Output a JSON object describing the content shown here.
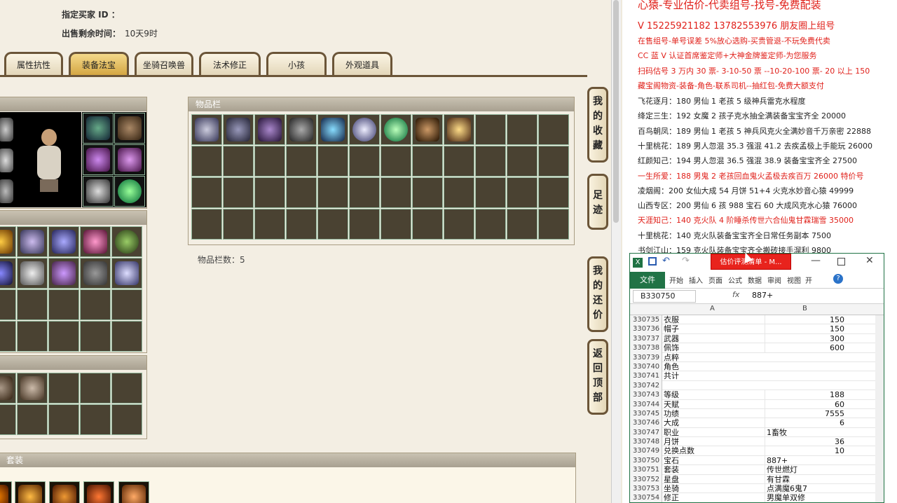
{
  "listing": {
    "buyer_label": "指定买家 ID ：",
    "buyer_value": "",
    "time_label": "出售剩余时间：",
    "time_value": "10天9时"
  },
  "tabs": [
    {
      "label": "属性抗性",
      "active": false
    },
    {
      "label": "装备法宝",
      "active": true
    },
    {
      "label": "坐骑召唤兽",
      "active": false
    },
    {
      "label": "法术修正",
      "active": false
    },
    {
      "label": "小孩",
      "active": false
    },
    {
      "label": "外观道具",
      "active": false
    }
  ],
  "inventory": {
    "header": "物品栏",
    "count_label": "物品栏数：5"
  },
  "bottom_panel": {
    "header": "套装"
  },
  "side_buttons": [
    {
      "label": "我的收藏"
    },
    {
      "label": "足迹"
    },
    {
      "label": "我的还价"
    },
    {
      "label": "返回顶部"
    }
  ],
  "ads": [
    {
      "text": "心猿-专业估价-代卖组号-找号-免费配装",
      "color": "red"
    },
    {
      "text": "V 15225921182   13782553976 朋友圈上组号",
      "color": "red"
    },
    {
      "text": "在售组号-单号误差 5%放心选购-买贵管退-不玩免费代卖",
      "color": "red"
    },
    {
      "text": "CC 蓝 V 认证首席鉴定师+大神金牌鉴定师-为您服务",
      "color": "red"
    },
    {
      "text": "扫码估号 3 万内 30 票- 3-10-50 票  --10-20-100 票- 20 以上 150",
      "color": "red"
    },
    {
      "text": "藏宝阁物资-装备-角色-联系司机--抽红包-免费大额支付",
      "color": "red"
    },
    {
      "text": "飞花逐月：180 男仙 1 老孩 5 级神兵雷克水程度",
      "color": "dark"
    },
    {
      "text": "绛定三生：192 女魔 2 孩子克水抽全满装备宝宝齐全 20000",
      "color": "dark"
    },
    {
      "text": "百鸟朝凤：189 男仙 1 老孩 5 神兵风克火全满妙音千万亲密 22888",
      "color": "dark"
    },
    {
      "text": "十里桃花：189 男人忽混 35.3 强混 41.2 去疾孟极上手能玩 26000",
      "color": "dark"
    },
    {
      "text": "红颜知己：194 男人忽混 36.5 强混 38.9 装备宝宝齐全 27500",
      "color": "dark"
    },
    {
      "text": "一生所爱：188 男鬼 2 老孩回血鬼火孟极去疾百万 26000 特价号",
      "color": "red"
    },
    {
      "text": "凌烟阁：200 女仙大成 54 月饼 51+4 火克水妙音心猿 49999",
      "color": "dark"
    },
    {
      "text": "山西专区：200 男仙 6 孩 988 宝石 60 大成风克水心猿 76000",
      "color": "dark"
    },
    {
      "text": "天涯知己：140 克火队 4 阶睡杀传世六合仙鬼甘霖瑞雪 35000",
      "color": "red"
    },
    {
      "text": "十里桃花：140 克火队装备宝宝齐全日常任务副本 7500",
      "color": "dark"
    },
    {
      "text": "书剑江山：159 克火队装备宝宝齐全搬砖接手溜利 9800",
      "color": "dark"
    }
  ],
  "excel": {
    "red_button": "估价评测清单 - M...",
    "file_tab": "文件",
    "ribbon_tabs": [
      "开始",
      "插入",
      "页面",
      "公式",
      "数据",
      "审阅",
      "视图",
      "开"
    ],
    "name_box": "B330750",
    "fx": "fx",
    "formula_value": "887+",
    "col_a": "A",
    "col_b": "B",
    "rows": [
      {
        "n": "330735",
        "a": "衣服",
        "b": "150",
        "num": true
      },
      {
        "n": "330736",
        "a": "帽子",
        "b": "150",
        "num": true
      },
      {
        "n": "330737",
        "a": "武器",
        "b": "300",
        "num": true
      },
      {
        "n": "330738",
        "a": "佩饰",
        "b": "600",
        "num": true
      },
      {
        "n": "330739",
        "a": "点粹",
        "b": "",
        "num": true
      },
      {
        "n": "330740",
        "a": "角色",
        "b": "",
        "num": true
      },
      {
        "n": "330741",
        "a": "共计",
        "b": "",
        "num": true
      },
      {
        "n": "330742",
        "a": "",
        "b": "",
        "num": true
      },
      {
        "n": "330743",
        "a": "等级",
        "b": "188",
        "num": true
      },
      {
        "n": "330744",
        "a": "天赋",
        "b": "60",
        "num": true
      },
      {
        "n": "330745",
        "a": "功绩",
        "b": "7555",
        "num": true
      },
      {
        "n": "330746",
        "a": "大成",
        "b": "6",
        "num": true
      },
      {
        "n": "330747",
        "a": "职业",
        "b": "1畜牧",
        "num": false
      },
      {
        "n": "330748",
        "a": "月饼",
        "b": "36",
        "num": true
      },
      {
        "n": "330749",
        "a": "兑换点数",
        "b": "10",
        "num": true
      },
      {
        "n": "330750",
        "a": "宝石",
        "b": "887+",
        "num": false
      },
      {
        "n": "330751",
        "a": "套装",
        "b": "传世燃灯",
        "num": false
      },
      {
        "n": "330752",
        "a": "星盘",
        "b": "有甘霖",
        "num": false
      },
      {
        "n": "330753",
        "a": "坐骑",
        "b": "点满魔6鬼7",
        "num": false
      },
      {
        "n": "330754",
        "a": "修正",
        "b": "男魔单双修",
        "num": false
      }
    ]
  }
}
